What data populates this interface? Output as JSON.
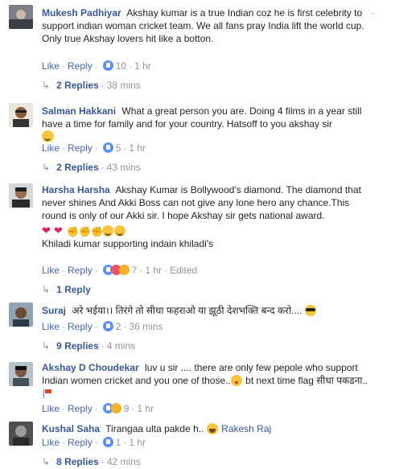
{
  "comments": [
    {
      "author": "Mukesh Padhiyar",
      "text": "Akshay kumar is a true Indian coz he is first celebrity to support indian woman cricket team. We all fans pray India lift the world cup.",
      "text2": "Only true Akshay lovers hit like a botton.",
      "like": "Like",
      "reply": "Reply",
      "count": "10",
      "time": "1 hr",
      "replies": "2 Replies",
      "replies_time": "38 mins"
    },
    {
      "author": "Salman Hakkani",
      "text": "What a great person you are. Doing 4 films in a year still have a time for family and for your country. Hatsoff to you akshay sir",
      "like": "Like",
      "reply": "Reply",
      "count": "5",
      "time": "1 hr",
      "replies": "2 Replies",
      "replies_time": "43 mins"
    },
    {
      "author": "Harsha Harsha",
      "text": "Akshay Kumar is Bollywood's diamond. The diamond that never shines And Akki Boss can not give any lone hero any chance.This round is only of our Akki sir. I hope Akshay sir gets national award.",
      "text2": "Khiladi kumar supporting indain khiladi's",
      "like": "Like",
      "reply": "Reply",
      "count": "7",
      "time": "1 hr",
      "edited": "Edited",
      "replies": "1 Reply"
    },
    {
      "author": "Suraj",
      "text": "अरे भईया।। तिरंगे तो सीधा फहराओ या झूठी देशभक्ति बन्द करो....",
      "like": "Like",
      "reply": "Reply",
      "count": "2",
      "time": "36 mins",
      "replies": "9 Replies",
      "replies_time": "4 mins"
    },
    {
      "author": "Akshay D Choudekar",
      "text": "luv u sir .... there are only few pepole who support Indian women cricket and you one of those..",
      "text_tail": "bt next time flag सीधा पकडना..",
      "like": "Like",
      "reply": "Reply",
      "count": "9",
      "time": "1 hr"
    },
    {
      "author": "Kushal Saha",
      "text": "Tirangaa ulta pakde h..",
      "mention": "Rakesh Raj",
      "like": "Like",
      "reply": "Reply",
      "count": "1",
      "time": "1 hr",
      "replies": "8 Replies",
      "replies_time": "42 mins"
    }
  ],
  "icons": {
    "like_reaction": "like-icon",
    "love_reaction": "love-icon",
    "sad_reaction": "sad-icon",
    "reply_arrow": "reply-arrow-icon",
    "chevron": "chevron-down-icon"
  },
  "colors": {
    "author": "#365899",
    "meta": "#90949c",
    "link": "#4267b2"
  }
}
